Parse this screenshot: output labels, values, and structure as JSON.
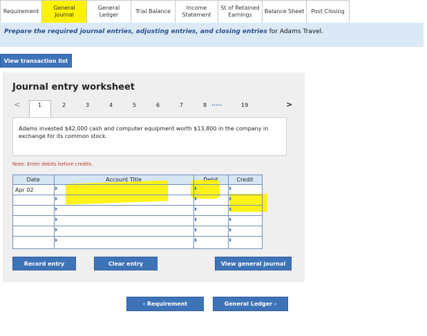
{
  "tabs": [
    {
      "label": "Requirement"
    },
    {
      "label": "General\nJournal"
    },
    {
      "label": "General\nLedger"
    },
    {
      "label": "Trial Balance"
    },
    {
      "label": "Income\nStatement"
    },
    {
      "label": "St of Retained\nEarnings"
    },
    {
      "label": "Balance Sheet"
    },
    {
      "label": "Post Closing"
    }
  ],
  "instruction": {
    "emphasis": "Prepare the required journal entries, adjusting entries, and closing entries",
    "rest": "for Adams Travel."
  },
  "view_transaction_label": "View transaction list",
  "worksheet": {
    "title": "Journal entry worksheet",
    "pager": {
      "prev": "<",
      "pages": [
        "1",
        "2",
        "3",
        "4",
        "5",
        "6",
        "7",
        "8"
      ],
      "ellipsis": "·····",
      "last": "19",
      "next": ">"
    },
    "description": "Adams invested $42,000 cash and computer equipment worth $13,800 in the company in exchange for its common stock.",
    "note": "Note: Enter debits before credits.",
    "table": {
      "headers": {
        "date": "Date",
        "account": "Account Title",
        "debit": "Debit",
        "credit": "Credit"
      },
      "first_date": "Apr 02"
    }
  },
  "buttons": {
    "record": "Record entry",
    "clear": "Clear entry",
    "view_journal": "View general journal",
    "prev_nav": "‹  Requirement",
    "next_nav": "General Ledger  ›"
  },
  "colors": {
    "accent": "#3f73b8",
    "highlight": "#fff200",
    "panel": "#efefef"
  }
}
